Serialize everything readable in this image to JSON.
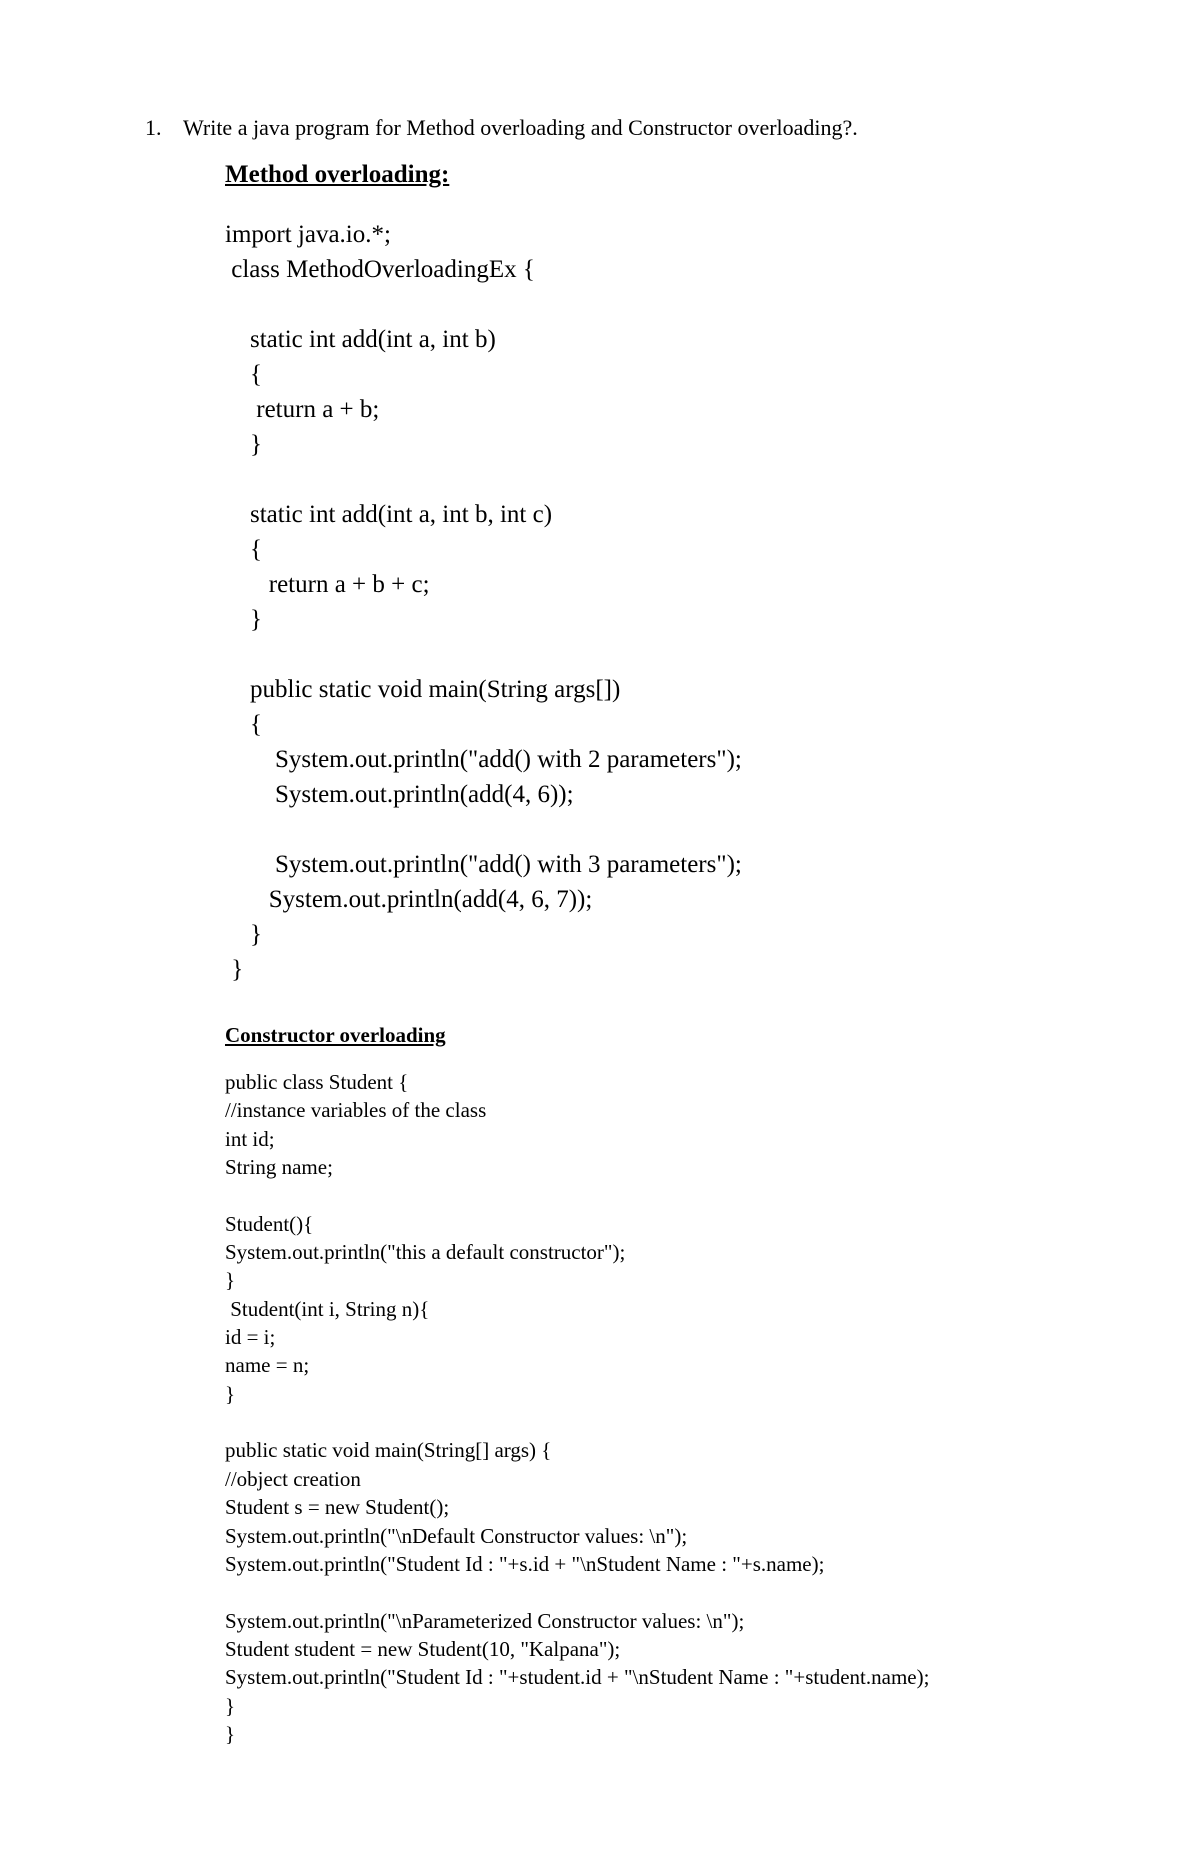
{
  "question": {
    "number": "1.",
    "text": "Write a java program for Method overloading and Constructor overloading?."
  },
  "section1": {
    "title": "Method overloading:",
    "code": "import java.io.*;\n class MethodOverloadingEx {\n\n    static int add(int a, int b)\n    {\n     return a + b;\n    }\n\n    static int add(int a, int b, int c)\n    {\n       return a + b + c;\n    }\n\n    public static void main(String args[])\n    {\n        System.out.println(\"add() with 2 parameters\");\n        System.out.println(add(4, 6));\n\n        System.out.println(\"add() with 3 parameters\");\n       System.out.println(add(4, 6, 7));\n    }\n }"
  },
  "section2": {
    "title": "Constructor overloading",
    "code": "public class Student {\n//instance variables of the class\nint id;\nString name;\n\nStudent(){\nSystem.out.println(\"this a default constructor\");\n}\n Student(int i, String n){\nid = i;\nname = n;\n}\n\npublic static void main(String[] args) {\n//object creation\nStudent s = new Student();\nSystem.out.println(\"\\nDefault Constructor values: \\n\");\nSystem.out.println(\"Student Id : \"+s.id + \"\\nStudent Name : \"+s.name);\n\nSystem.out.println(\"\\nParameterized Constructor values: \\n\");\nStudent student = new Student(10, \"Kalpana\");\nSystem.out.println(\"Student Id : \"+student.id + \"\\nStudent Name : \"+student.name);\n}\n}"
  }
}
